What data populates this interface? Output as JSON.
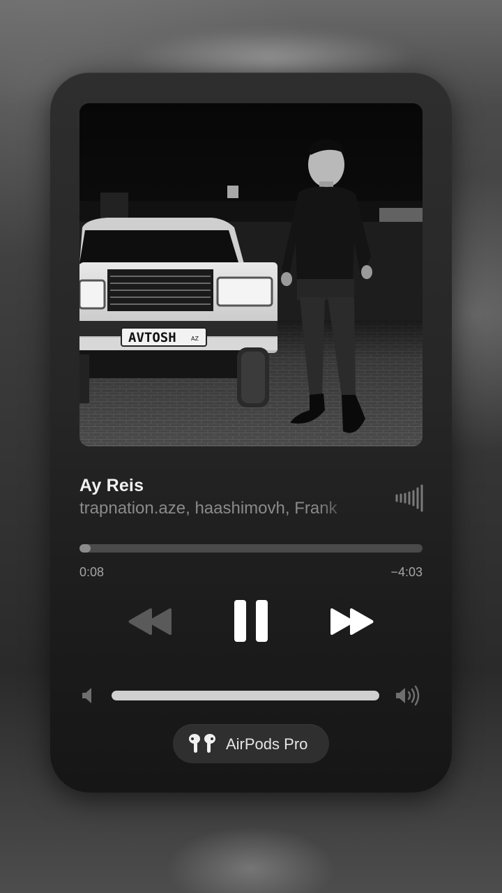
{
  "now_playing": {
    "title": "Ay Reis",
    "artist": "trapnation.aze, haashimovh, Frank",
    "artwork": {
      "plate_text": "AVTOSH",
      "plate_small_text": "AZ",
      "description_icon": "album-artwork"
    }
  },
  "progress": {
    "elapsed": "0:08",
    "remaining": "−4:03",
    "fraction": 0.032
  },
  "controls": {
    "rewind_icon": "rewind-icon",
    "pause_icon": "pause-icon",
    "forward_icon": "fast-forward-icon"
  },
  "volume": {
    "level": 1.0,
    "low_icon": "speaker-low-icon",
    "high_icon": "speaker-high-icon"
  },
  "output_device": {
    "label": "AirPods Pro",
    "icon": "airpods-icon"
  },
  "colors": {
    "card_background": "#262626",
    "text_primary": "#f2f2f2",
    "text_secondary": "#8a8a8a",
    "track": "#4a4a4a"
  }
}
